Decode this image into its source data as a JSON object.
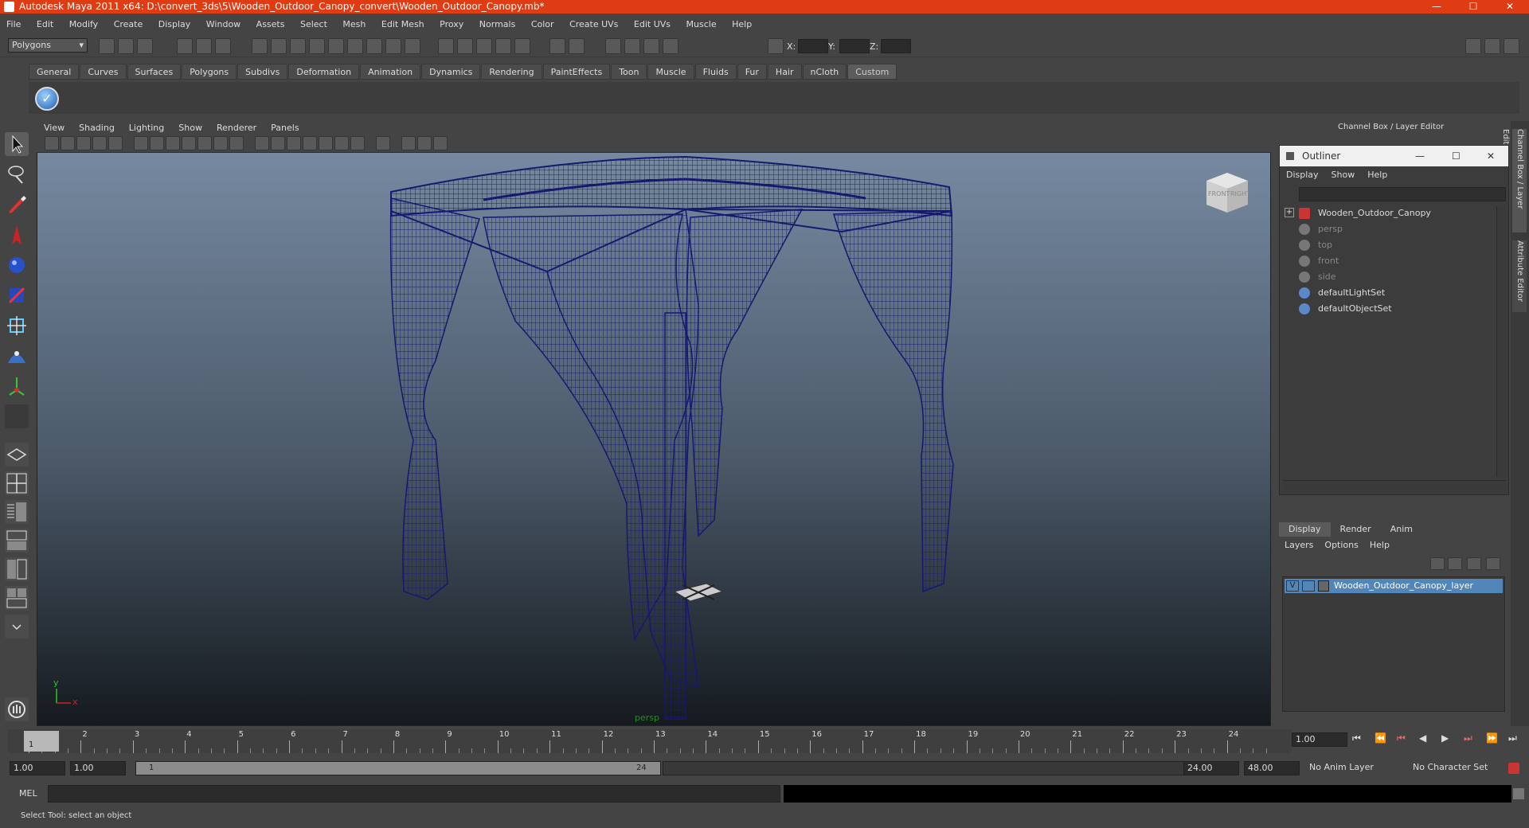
{
  "app": {
    "title": "Autodesk Maya 2011 x64: D:\\convert_3ds\\5\\Wooden_Outdoor_Canopy_convert\\Wooden_Outdoor_Canopy.mb*",
    "window_controls": {
      "minimize": "—",
      "maximize": "☐",
      "close": "✕"
    }
  },
  "menubar": [
    "File",
    "Edit",
    "Modify",
    "Create",
    "Display",
    "Window",
    "Assets",
    "Select",
    "Mesh",
    "Edit Mesh",
    "Proxy",
    "Normals",
    "Color",
    "Create UVs",
    "Edit UVs",
    "Muscle",
    "Help"
  ],
  "statusline": {
    "menu_set": "Polygons",
    "xyz": {
      "x": "X:",
      "y": "Y:",
      "z": "Z:"
    }
  },
  "shelf": {
    "tabs": [
      "General",
      "Curves",
      "Surfaces",
      "Polygons",
      "Subdivs",
      "Deformation",
      "Animation",
      "Dynamics",
      "Rendering",
      "PaintEffects",
      "Toon",
      "Muscle",
      "Fluids",
      "Fur",
      "Hair",
      "nCloth",
      "Custom"
    ],
    "active_tab": "Custom"
  },
  "viewport": {
    "menu": [
      "View",
      "Shading",
      "Lighting",
      "Show",
      "Renderer",
      "Panels"
    ],
    "camera_label": "persp",
    "viewcube": {
      "front": "FRONT",
      "right": "RIGHT"
    },
    "axis": {
      "y": "y",
      "x": "x"
    },
    "wire_color": "#1c1f7a"
  },
  "channel_box": {
    "title": "Channel Box / Layer Editor",
    "side_tabs": [
      "Channel Box / Layer Editor",
      "Attribute Editor"
    ]
  },
  "outliner": {
    "title": "Outliner",
    "menu": [
      "Display",
      "Show",
      "Help"
    ],
    "items": [
      {
        "label": "Wooden_Outdoor_Canopy",
        "dim": false
      },
      {
        "label": "persp",
        "dim": true
      },
      {
        "label": "top",
        "dim": true
      },
      {
        "label": "front",
        "dim": true
      },
      {
        "label": "side",
        "dim": true
      },
      {
        "label": "defaultLightSet",
        "dim": false
      },
      {
        "label": "defaultObjectSet",
        "dim": false
      }
    ]
  },
  "layer_editor": {
    "tabs": [
      "Display",
      "Render",
      "Anim"
    ],
    "menu": [
      "Layers",
      "Options",
      "Help"
    ],
    "layer": {
      "visible": "V",
      "name": "Wooden_Outdoor_Canopy_layer"
    }
  },
  "timeline": {
    "ticks": [
      "1",
      "2",
      "3",
      "4",
      "5",
      "6",
      "7",
      "8",
      "9",
      "10",
      "11",
      "12",
      "13",
      "14",
      "15",
      "16",
      "17",
      "18",
      "19",
      "20",
      "21",
      "22",
      "23",
      "24"
    ],
    "current_frame": "1.00",
    "current_marker": "1"
  },
  "range": {
    "start_time": "1.00",
    "playback_start": "1.00",
    "slider_start": "1",
    "slider_end": "24",
    "playback_end": "24.00",
    "end_time": "48.00",
    "anim_layer": "No Anim Layer",
    "character_set": "No Character Set"
  },
  "command_line": {
    "label": "MEL"
  },
  "help_line": {
    "text": "Select Tool: select an object"
  }
}
